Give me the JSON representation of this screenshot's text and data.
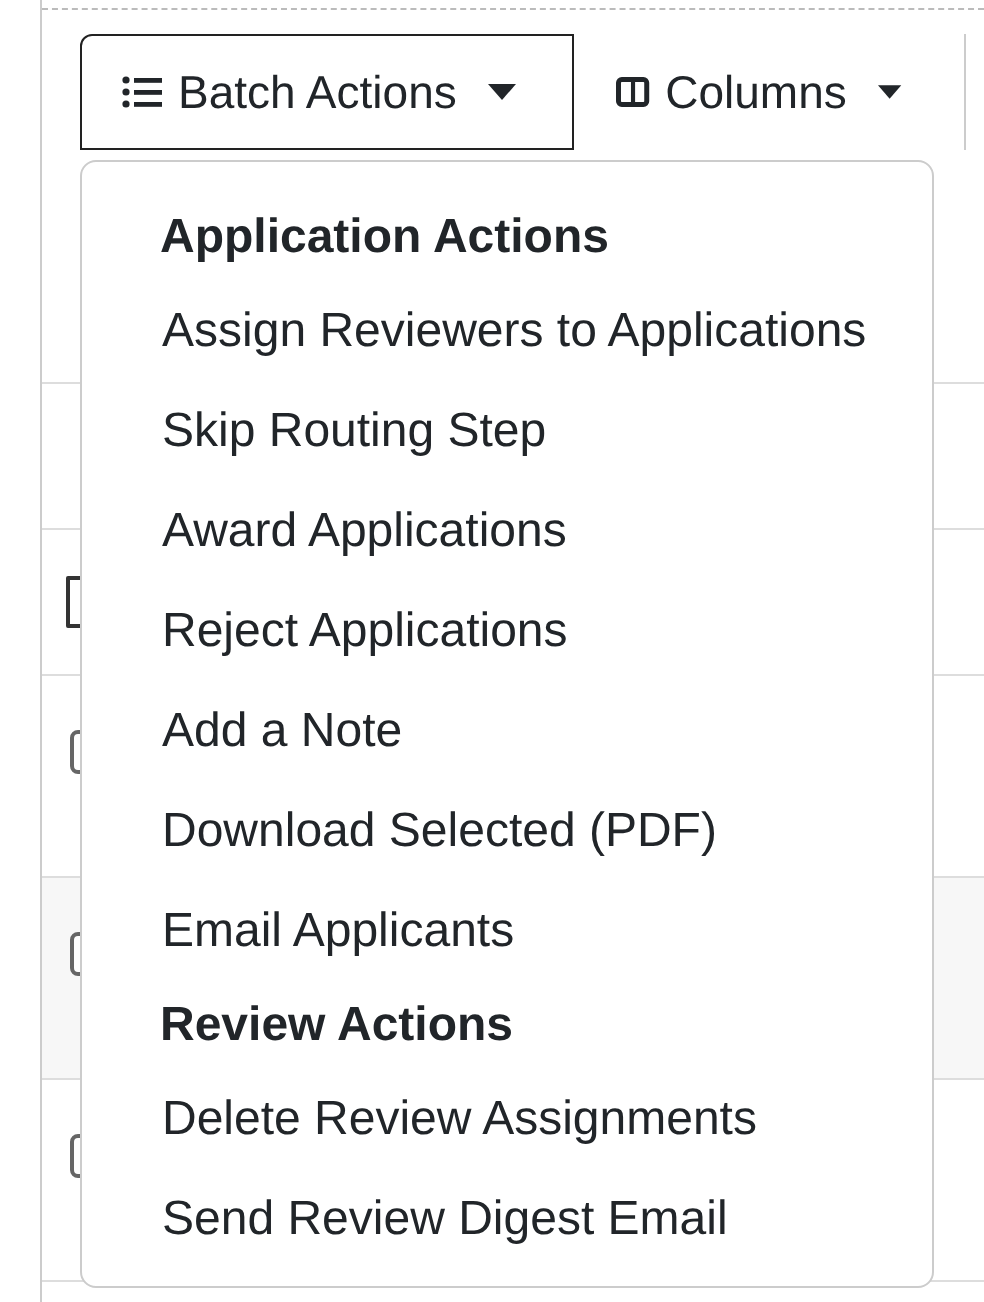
{
  "toolbar": {
    "buttons": [
      {
        "label": "Batch Actions",
        "expanded": true
      },
      {
        "label": "Columns",
        "expanded": false
      }
    ]
  },
  "table": {
    "select_all": {
      "checked": false
    },
    "rows": [
      {
        "checked": false
      },
      {
        "checked": false
      },
      {
        "checked": false
      }
    ]
  },
  "menu": {
    "items": [
      {
        "kind": "header",
        "label": "Application Actions"
      },
      {
        "kind": "item",
        "label": "Assign Reviewers to Applications"
      },
      {
        "kind": "item",
        "label": "Skip Routing Step"
      },
      {
        "kind": "item",
        "label": "Award Applications"
      },
      {
        "kind": "item",
        "label": "Reject Applications"
      },
      {
        "kind": "item",
        "label": "Add a Note"
      },
      {
        "kind": "item",
        "label": "Download Selected (PDF)"
      },
      {
        "kind": "item",
        "label": "Email Applicants"
      },
      {
        "kind": "header",
        "label": "Review Actions"
      },
      {
        "kind": "item",
        "label": "Delete Review Assignments"
      },
      {
        "kind": "item",
        "label": "Send Review Digest Email"
      }
    ]
  }
}
